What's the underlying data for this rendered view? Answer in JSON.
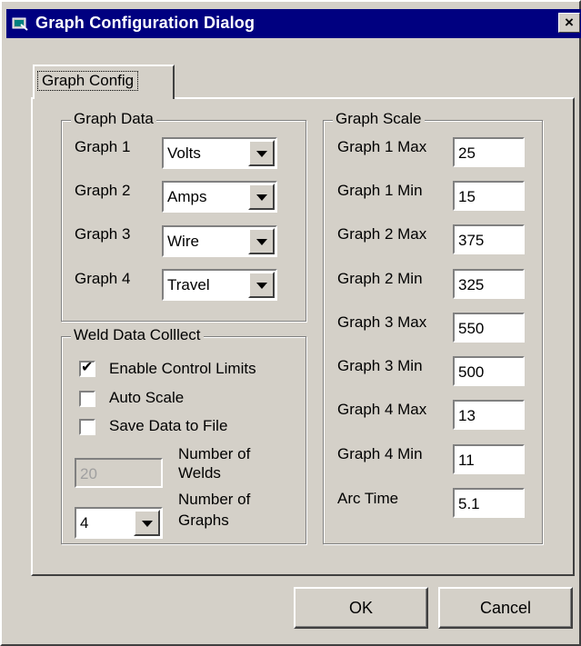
{
  "window": {
    "title": "Graph Configuration Dialog",
    "close_label": "×"
  },
  "tab": {
    "label": "Graph Config"
  },
  "graph_data": {
    "title": "Graph Data",
    "rows": [
      {
        "label": "Graph 1",
        "value": "Volts"
      },
      {
        "label": "Graph 2",
        "value": "Amps"
      },
      {
        "label": "Graph 3",
        "value": "Wire"
      },
      {
        "label": "Graph 4",
        "value": "Travel"
      }
    ]
  },
  "weld_data": {
    "title": "Weld Data Colllect",
    "checkboxes": [
      {
        "label": "Enable Control Limits",
        "checked": true,
        "mark": "✔"
      },
      {
        "label": "Auto Scale",
        "checked": false
      },
      {
        "label": "Save Data to File",
        "checked": false
      }
    ],
    "welds": {
      "value": "20",
      "label_line1": "Number of",
      "label_line2": "Welds"
    },
    "graphs": {
      "value": "4",
      "label_line1": "Number of",
      "label_line2": "Graphs"
    }
  },
  "graph_scale": {
    "title": "Graph Scale",
    "rows": [
      {
        "label": "Graph 1 Max",
        "value": "25"
      },
      {
        "label": "Graph 1 Min",
        "value": "15"
      },
      {
        "label": "Graph 2 Max",
        "value": "375"
      },
      {
        "label": "Graph 2 Min",
        "value": "325"
      },
      {
        "label": "Graph 3 Max",
        "value": "550"
      },
      {
        "label": "Graph 3 Min",
        "value": "500"
      },
      {
        "label": "Graph 4 Max",
        "value": "13"
      },
      {
        "label": "Graph 4 Min",
        "value": "11"
      },
      {
        "label": "Arc Time",
        "value": "5.1"
      }
    ]
  },
  "buttons": {
    "ok": "OK",
    "cancel": "Cancel"
  }
}
